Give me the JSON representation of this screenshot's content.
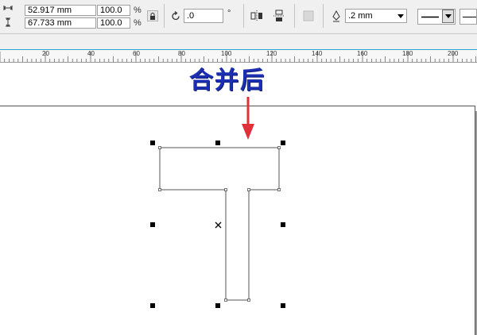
{
  "toolbar": {
    "width_value": "52.917 mm",
    "height_value": "67.733 mm",
    "scale_x": "100.0",
    "scale_y": "100.0",
    "percent_x": "%",
    "percent_y": "%",
    "rotation_value": ".0",
    "degree_symbol": "°",
    "outline_width": ".2 mm",
    "colors": {
      "field_border": "#a0a0a0",
      "background": "#f0f0f0"
    }
  },
  "ruler": {
    "labels": [
      "20",
      "40",
      "60",
      "80",
      "100",
      "120",
      "140",
      "160",
      "180",
      "200"
    ],
    "accent": "#2aa3c9"
  },
  "canvas": {
    "banner_text": "合并后",
    "banner_color": "#1c2fb0",
    "arrow_color": "#e0303a"
  }
}
